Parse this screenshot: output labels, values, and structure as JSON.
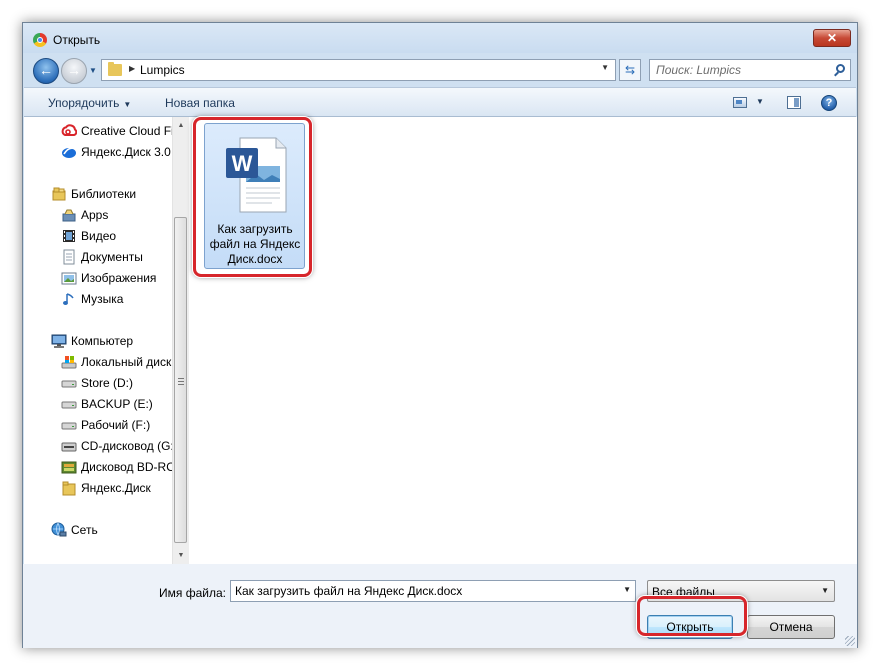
{
  "window": {
    "title": "Открыть",
    "close_symbol": "✕"
  },
  "address": {
    "path": "Lumpics",
    "search_placeholder": "Поиск: Lumpics"
  },
  "toolbar": {
    "organize": "Упорядочить",
    "new_folder": "Новая папка",
    "help_symbol": "?"
  },
  "nav": {
    "items": [
      {
        "label": "Creative Cloud Files",
        "icon": "creative-cloud-icon"
      },
      {
        "label": "Яндекс.Диск 3.0",
        "icon": "yandex-disk-icon"
      },
      {
        "label": "Библиотеки",
        "icon": "libraries-icon"
      },
      {
        "label": "Apps",
        "icon": "apps-icon"
      },
      {
        "label": "Видео",
        "icon": "video-icon"
      },
      {
        "label": "Документы",
        "icon": "documents-icon"
      },
      {
        "label": "Изображения",
        "icon": "images-icon"
      },
      {
        "label": "Музыка",
        "icon": "music-icon"
      },
      {
        "label": "Компьютер",
        "icon": "computer-icon"
      },
      {
        "label": "Локальный диск (C:)",
        "icon": "local-disk-icon"
      },
      {
        "label": "Store (D:)",
        "icon": "drive-icon"
      },
      {
        "label": "BACKUP (E:)",
        "icon": "drive-icon"
      },
      {
        "label": "Рабочий (F:)",
        "icon": "drive-icon"
      },
      {
        "label": "CD-дисковод (G:)",
        "icon": "cd-drive-icon"
      },
      {
        "label": "Дисковод BD-ROM",
        "icon": "bd-drive-icon"
      },
      {
        "label": "Яндекс.Диск",
        "icon": "folder-icon"
      },
      {
        "label": "Сеть",
        "icon": "network-icon"
      }
    ]
  },
  "files": [
    {
      "name": "Как загрузить файл на Яндекс Диск.docx",
      "name_lines": [
        "Как загрузить",
        "файл на Яндекс",
        "Диск.docx"
      ],
      "icon": "word-document-icon",
      "selected": true
    }
  ],
  "bottom": {
    "filename_label": "Имя файла:",
    "filename_value": "Как загрузить файл на Яндекс Диск.docx",
    "filetype": "Все файлы",
    "open_button": "Открыть",
    "cancel_button": "Отмена"
  },
  "colors": {
    "highlight": "#d7262b",
    "selection": "#cce4fb",
    "word_blue": "#2b5797"
  }
}
